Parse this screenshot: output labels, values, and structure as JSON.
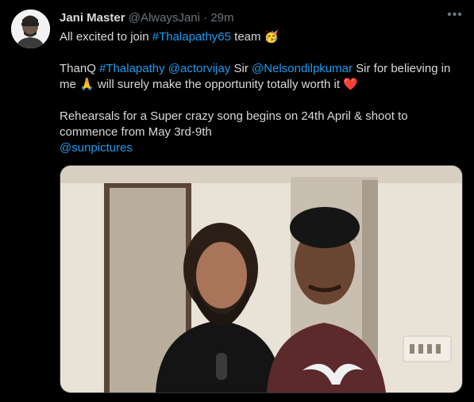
{
  "tweet": {
    "author_name": "Jani Master",
    "author_handle": "@AlwaysJani",
    "separator": "·",
    "time": "29m",
    "more_label": "•••",
    "line1_text": "All excited to join ",
    "line1_hashtag": "#Thalapathy65",
    "line1_tail": " team ",
    "line1_emoji": "🥳",
    "line2_text1": "ThanQ ",
    "line2_hashtag": "#Thalapathy",
    "line2_space": " ",
    "line2_mention1": "@actorvijay",
    "line2_text2": " Sir ",
    "line2_mention2": "@Nelsondilpkumar",
    "line2_text3": " Sir for believing in me ",
    "line2_emoji1": "🙏",
    "line2_text4": " will surely make the opportunity totally worth it ",
    "line2_emoji2": "❤️",
    "line3_text": "Rehearsals for a Super crazy song begins on 24th April & shoot to commence from May 3rd-9th",
    "line3_mention": "@sunpictures"
  },
  "colors": {
    "background": "#000000",
    "text": "#d9d9d9",
    "muted": "#6e767d",
    "link": "#1d9bf0",
    "heart": "#e0245e"
  }
}
